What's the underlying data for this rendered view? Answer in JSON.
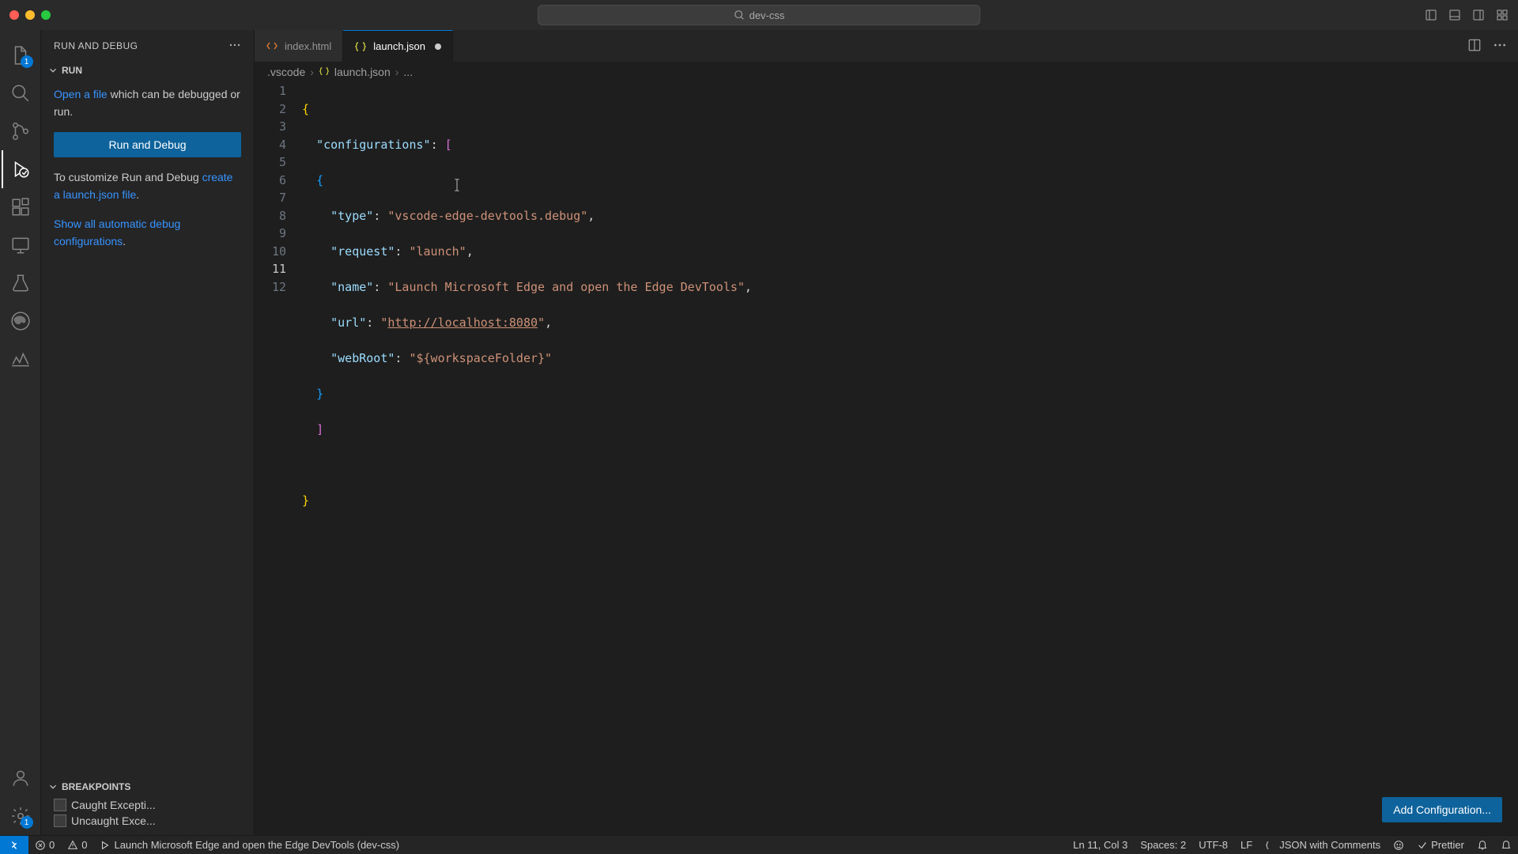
{
  "titlebar": {
    "project": "dev-css"
  },
  "activity": {
    "explorer_badge": "1",
    "settings_badge": "1"
  },
  "sidebar": {
    "title": "RUN AND DEBUG",
    "run_section": "RUN",
    "open_file_link": "Open a file",
    "open_file_suffix": " which can be debugged or run.",
    "run_debug_btn": "Run and Debug",
    "customize_prefix": "To customize Run and Debug ",
    "create_link": "create a launch.json file",
    "show_all_link": "Show all automatic debug configurations",
    "breakpoints_title": "BREAKPOINTS",
    "bp_caught": "Caught Excepti...",
    "bp_uncaught": "Uncaught Exce..."
  },
  "tabs": {
    "t0": {
      "label": "index.html"
    },
    "t1": {
      "label": "launch.json"
    }
  },
  "breadcrumb": {
    "seg0": ".vscode",
    "seg1": "launch.json",
    "seg2": "..."
  },
  "editor": {
    "lines": {
      "n1": "1",
      "n2": "2",
      "n3": "3",
      "n4": "4",
      "n5": "5",
      "n6": "6",
      "n7": "7",
      "n8": "8",
      "n9": "9",
      "n10": "10",
      "n11": "11",
      "n12": "12"
    },
    "code": {
      "l1_open": "{",
      "l2_key": "\"configurations\"",
      "l2_colon": ": ",
      "l2_br": "[",
      "l3_open": "{",
      "l4_key": "\"type\"",
      "l4_val": "\"vscode-edge-devtools.debug\"",
      "l5_key": "\"request\"",
      "l5_val": "\"launch\"",
      "l6_key": "\"name\"",
      "l6_val": "\"Launch Microsoft Edge and open the Edge DevTools\"",
      "l7_key": "\"url\"",
      "l7_q1": "\"",
      "l7_url": "http://localhost:8080",
      "l7_q2": "\"",
      "l8_key": "\"webRoot\"",
      "l8_val": "\"${workspaceFolder}\"",
      "l9_close": "}",
      "l10_close": "]",
      "l12_close": "}",
      "comma": ","
    }
  },
  "buttons": {
    "add_config": "Add Configuration..."
  },
  "statusbar": {
    "errors": "0",
    "warnings": "0",
    "launch": "Launch Microsoft Edge and open the Edge DevTools (dev-css)",
    "cursor": "Ln 11, Col 3",
    "spaces": "Spaces: 2",
    "encoding": "UTF-8",
    "eol": "LF",
    "lang": "JSON with Comments",
    "prettier": "Prettier"
  }
}
